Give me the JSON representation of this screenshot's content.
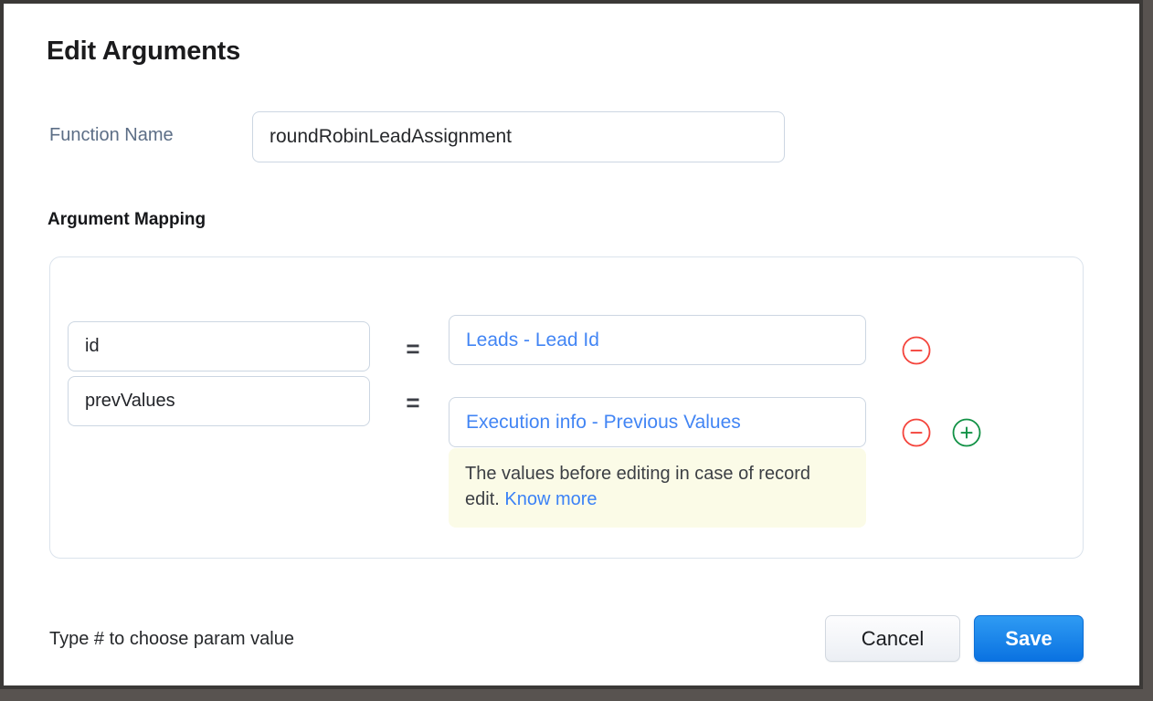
{
  "dialog": {
    "title": "Edit Arguments"
  },
  "function": {
    "label": "Function Name",
    "value": "roundRobinLeadAssignment",
    "placeholder": ""
  },
  "argument_mapping": {
    "section_title": "Argument Mapping",
    "equals_symbol": "=",
    "rows": [
      {
        "param": "id",
        "param_placeholder": "",
        "value": "Leads - Lead Id",
        "value_placeholder": "",
        "remove_icon": "minus-circle-icon",
        "has_add": false
      },
      {
        "param": "prevValues",
        "param_placeholder": "",
        "value": "Execution info - Previous Values",
        "value_placeholder": "",
        "remove_icon": "minus-circle-icon",
        "add_icon": "plus-circle-icon",
        "has_add": true
      }
    ],
    "hint": {
      "text": "The values before editing in case of record edit. ",
      "link_label": "Know more"
    }
  },
  "footer": {
    "hint": "Type # to choose param value",
    "cancel_label": "Cancel",
    "save_label": "Save"
  },
  "colors": {
    "accent_blue": "#4285f4",
    "save_blue": "#0a72e1",
    "remove_red": "#f4433b",
    "add_green": "#119145",
    "hint_bg": "#fbfbe7",
    "label_slate": "#5c6e86",
    "chrome_dark": "#3b3937",
    "page_bg": "#585350"
  }
}
